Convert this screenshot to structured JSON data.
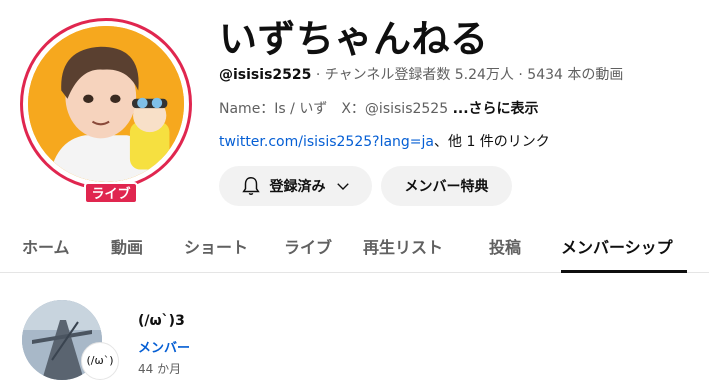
{
  "channel": {
    "title": "いずちゃんねる",
    "handle": "@isisis2525",
    "separator": " · ",
    "subscribers": "チャンネル登録者数 5.24万人",
    "videos": "5434 本の動画",
    "description": "Name：Is / いず　X：@isisis2525 ",
    "more_label": "...さらに表示",
    "link": "twitter.com/isisis2525?lang=ja",
    "other_links": "、他 1 件のリンク",
    "live_badge": "ライブ"
  },
  "buttons": {
    "subscribed_label": "登録済み",
    "membership_label": "メンバー特典"
  },
  "tabs": [
    {
      "label": "ホーム"
    },
    {
      "label": "動画"
    },
    {
      "label": "ショート"
    },
    {
      "label": "ライブ"
    },
    {
      "label": "再生リスト"
    },
    {
      "label": "投稿"
    },
    {
      "label": "メンバーシップ",
      "active": true
    }
  ],
  "member": {
    "name": "(/ω`)3",
    "badge": "(/ω`)",
    "level": "メンバー",
    "duration": "44 か月"
  },
  "colors": {
    "live_red": "#e0264f",
    "link_blue": "#065fd4",
    "button_bg": "#f2f2f2",
    "text_secondary": "#606060"
  },
  "icons": {
    "bell": "bell-icon",
    "chevron": "chevron-down-icon"
  }
}
